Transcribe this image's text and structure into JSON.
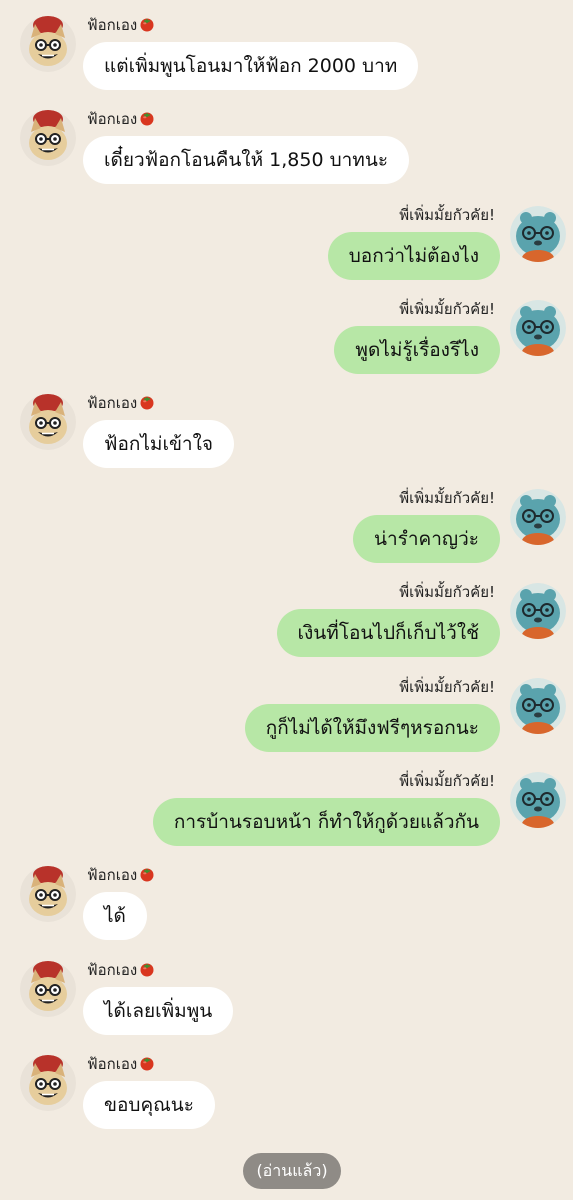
{
  "contacts": {
    "other": {
      "name": "ฟ้อกเอง",
      "name_emoji": "tomato-icon"
    },
    "me": {
      "name": "พี่เพิ่มมั้ยกัวคัย!"
    }
  },
  "messages": [
    {
      "side": "in",
      "text": "แต่เพิ่มพูนโอนมาให้ฟ้อก 2000 บาท"
    },
    {
      "side": "in",
      "text": "เดี๋ยวฟ้อกโอนคืนให้ 1,850 บาทนะ"
    },
    {
      "side": "out",
      "text": "บอกว่าไม่ต้องไง"
    },
    {
      "side": "out",
      "text": "พูดไม่รู้เรื่องรึไง"
    },
    {
      "side": "in",
      "text": "ฟ้อกไม่เข้าใจ"
    },
    {
      "side": "out",
      "text": "น่ารำคาญว่ะ"
    },
    {
      "side": "out",
      "text": "เงินที่โอนไปก็เก็บไว้ใช้"
    },
    {
      "side": "out",
      "text": "กูก็ไม่ได้ให้มึงฟรีๆหรอกนะ"
    },
    {
      "side": "out",
      "text": "การบ้านรอบหน้า ก็ทำให้กูด้วยแล้วกัน"
    },
    {
      "side": "in",
      "text": "ได้"
    },
    {
      "side": "in",
      "text": "ได้เลยเพิ่มพูน"
    },
    {
      "side": "in",
      "text": "ขอบคุณนะ"
    }
  ],
  "status": {
    "read_label": "(อ่านแล้ว)"
  },
  "colors": {
    "background": "#f2ebe1",
    "incoming_bubble": "#ffffff",
    "outgoing_bubble": "#b7e7a6",
    "read_pill": "#8f8b86"
  }
}
